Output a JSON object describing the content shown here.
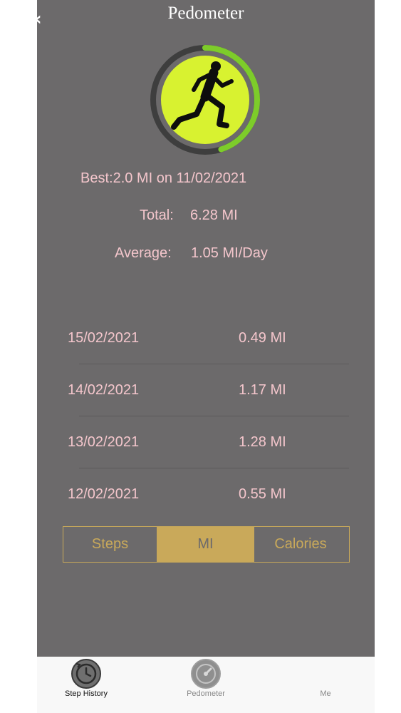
{
  "header": {
    "title": "Pedometer",
    "back_icon": "chevron-left-icon"
  },
  "summary": {
    "best": "Best:2.0 MI on 11/02/2021",
    "total_label": "Total:",
    "total_value": "6.28 MI",
    "average_label": "Average:",
    "average_value": "1.05 MI/Day",
    "progress_fraction": 0.45
  },
  "history": [
    {
      "date": "15/02/2021",
      "value": "0.49 MI"
    },
    {
      "date": "14/02/2021",
      "value": "1.17 MI"
    },
    {
      "date": "13/02/2021",
      "value": "1.28 MI"
    },
    {
      "date": "12/02/2021",
      "value": "0.55 MI"
    }
  ],
  "units": {
    "options": [
      "Steps",
      "MI",
      "Calories"
    ],
    "selected": "MI"
  },
  "tabbar": {
    "items": [
      {
        "label": "Step History",
        "icon": "history-clock-icon",
        "active": true
      },
      {
        "label": "Pedometer",
        "icon": "speedometer-icon",
        "active": false
      },
      {
        "label": "Me",
        "icon": "",
        "active": false
      }
    ]
  },
  "colors": {
    "background": "#6c6a6b",
    "text": "#f4c6cc",
    "accent_gold": "#c9a95a",
    "ring_green": "#7dcc2a",
    "ring_track": "#3e3e3e",
    "disc": "#d8f230"
  }
}
